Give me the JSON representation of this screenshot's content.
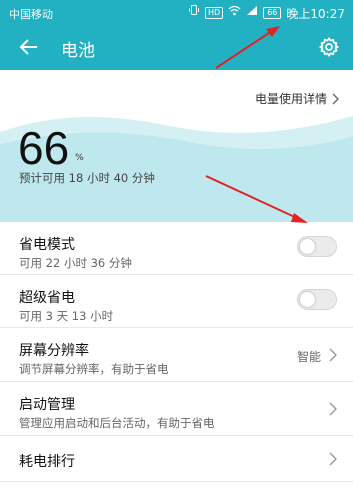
{
  "status_bar": {
    "carrier": "中国移动",
    "battery": "66",
    "clock": "晚上10:27",
    "icons": [
      "vibrate-icon",
      "hd-icon",
      "wifi-icon",
      "signal-icon",
      "battery-icon"
    ]
  },
  "toolbar": {
    "title": "电池",
    "back_icon": "arrow-left-icon",
    "settings_icon": "gear-icon"
  },
  "hero": {
    "usage_details_link": "电量使用详情",
    "percent": "66",
    "percent_unit": "%",
    "estimate": "预计可用 18 小时 40 分钟"
  },
  "settings": {
    "power_saving": {
      "title": "省电模式",
      "subtitle": "可用 22 小时 36 分钟",
      "enabled": false
    },
    "ultra_power_saving": {
      "title": "超级省电",
      "subtitle": "可用 3 天 13 小时",
      "enabled": false
    },
    "screen_resolution": {
      "title": "屏幕分辨率",
      "subtitle": "调节屏幕分辨率，有助于省电",
      "value": "智能"
    },
    "startup_manager": {
      "title": "启动管理",
      "subtitle": "管理应用启动和后台活动，有助于省电"
    },
    "power_ranking": {
      "title": "耗电排行"
    }
  },
  "colors": {
    "accent": "#21b1c3",
    "annotation_arrow": "#e02424"
  }
}
